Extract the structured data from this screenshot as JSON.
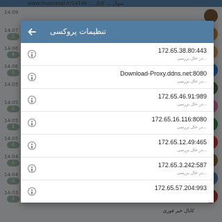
{
  "background": {
    "top_text": "www.musicesal.ir/14146 ... سوال ... کانال",
    "top_name": "kalamehtv کانال",
    "times": [
      "14:09",
      "14:07",
      "14:06",
      "14:06",
      "14:05",
      "14:05",
      "14:05",
      "14:05",
      "14:04",
      "14:04",
      "14:03"
    ],
    "badges": [
      "",
      "1",
      "4",
      "1",
      "",
      "1",
      "5",
      "2",
      "1",
      "1",
      "3"
    ],
    "bottom_text": "کانال خبر فوری"
  },
  "dialog": {
    "title": "تنظیمات پروکسی",
    "proxies": [
      {
        "address": "172.65.38.80:443",
        "status": "در حال بررسی..."
      },
      {
        "address": "Download-Proxy.ddns.net:8080",
        "status": "در حال بررسی..."
      },
      {
        "address": "172.65.46.91:989",
        "status": "در حال بررسی..."
      },
      {
        "address": "172.65.16.116:8080",
        "status": "در حال بررسی..."
      },
      {
        "address": "172.65.12.49:465",
        "status": "در حال بررسی..."
      },
      {
        "address": "172.65.3.242:587",
        "status": "در حال بررسی..."
      },
      {
        "address": "172.65.57.204:993",
        "status": ""
      }
    ]
  },
  "colors": {
    "header": "#527da3",
    "overlay": "rgba(0,0,0,0.5)"
  },
  "icons": {
    "back": "arrow-left-icon",
    "info": "info-circle-icon"
  }
}
